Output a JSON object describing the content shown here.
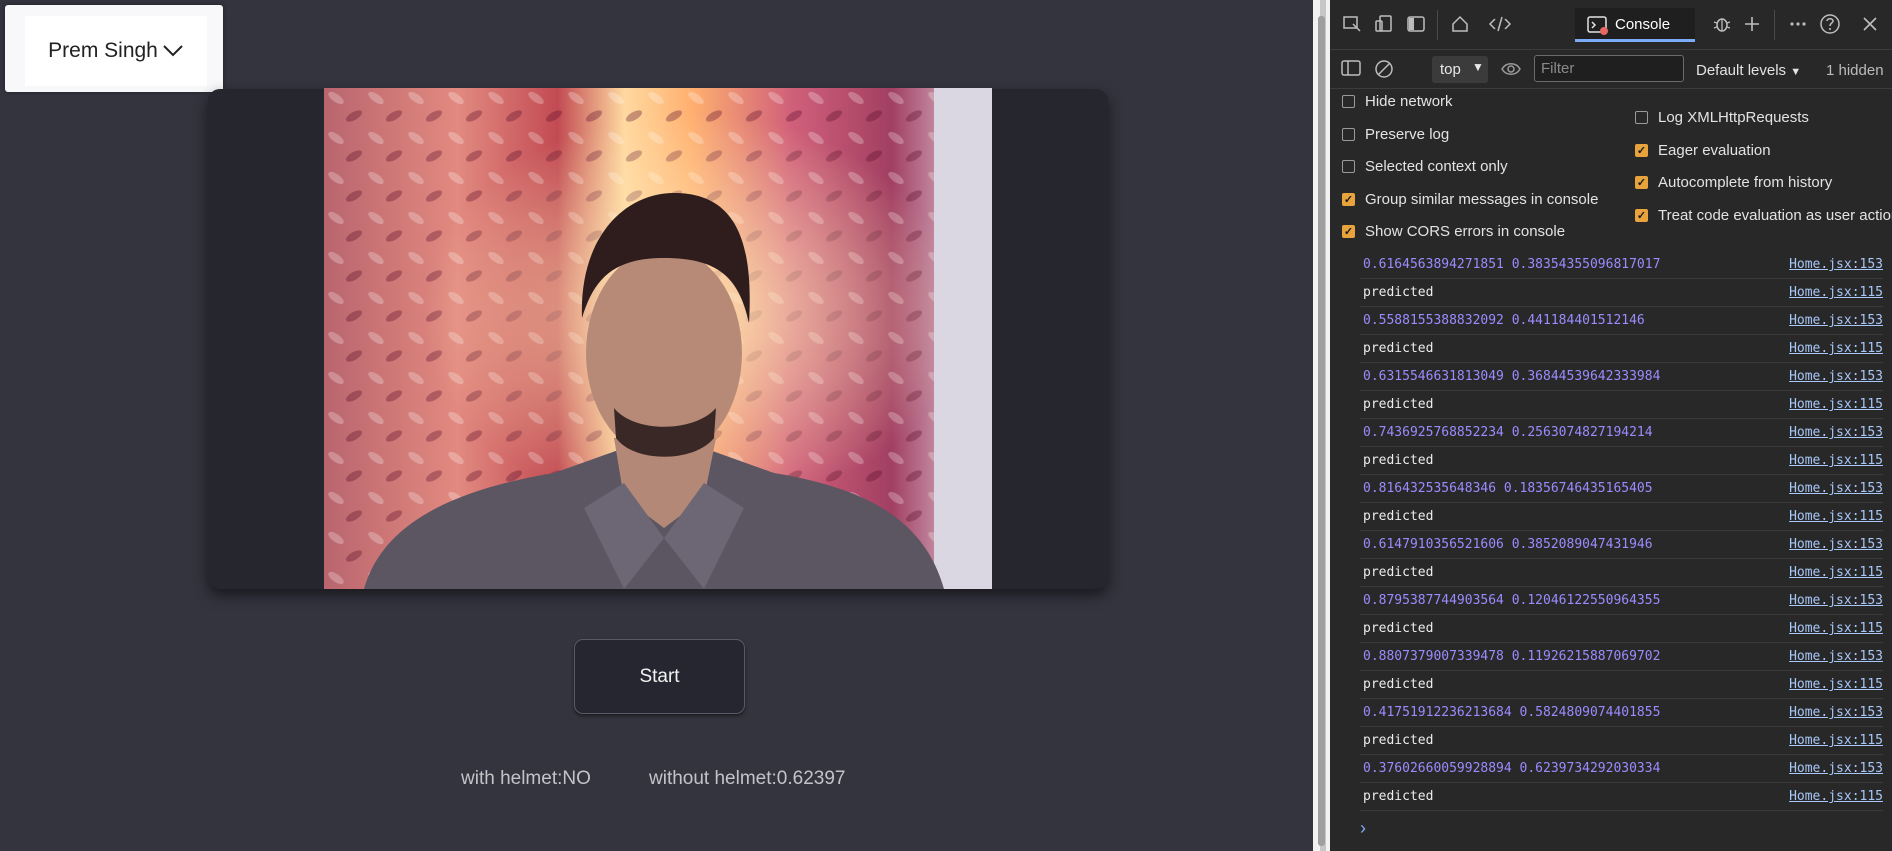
{
  "app": {
    "user_name": "Prem Singh",
    "start_label": "Start",
    "with_helmet": "with helmet:NO",
    "without_helmet": "without helmet:0.62397"
  },
  "devtools": {
    "tab_console": "Console",
    "context": "top",
    "filter_placeholder": "Filter",
    "levels": "Default levels",
    "hidden": "1 hidden",
    "settings_left": [
      {
        "label": "Hide network",
        "checked": false
      },
      {
        "label": "Preserve log",
        "checked": false
      },
      {
        "label": "Selected context only",
        "checked": false
      },
      {
        "label": "Group similar messages in console",
        "checked": true
      },
      {
        "label": "Show CORS errors in console",
        "checked": true
      }
    ],
    "settings_right": [
      {
        "label": "Log XMLHttpRequests",
        "checked": false
      },
      {
        "label": "Eager evaluation",
        "checked": true
      },
      {
        "label": "Autocomplete from history",
        "checked": true
      },
      {
        "label": "Treat code evaluation as user action",
        "checked": true
      }
    ],
    "log": [
      {
        "msg": "0.6164563894271851 0.38354355096817017",
        "src": "Home.jsx:153",
        "kind": "num"
      },
      {
        "msg": "predicted",
        "src": "Home.jsx:115",
        "kind": "txt"
      },
      {
        "msg": "0.5588155388832092 0.441184401512146",
        "src": "Home.jsx:153",
        "kind": "num"
      },
      {
        "msg": "predicted",
        "src": "Home.jsx:115",
        "kind": "txt"
      },
      {
        "msg": "0.6315546631813049 0.36844539642333984",
        "src": "Home.jsx:153",
        "kind": "num"
      },
      {
        "msg": "predicted",
        "src": "Home.jsx:115",
        "kind": "txt"
      },
      {
        "msg": "0.7436925768852234 0.2563074827194214",
        "src": "Home.jsx:153",
        "kind": "num"
      },
      {
        "msg": "predicted",
        "src": "Home.jsx:115",
        "kind": "txt"
      },
      {
        "msg": "0.816432535648346 0.18356746435165405",
        "src": "Home.jsx:153",
        "kind": "num"
      },
      {
        "msg": "predicted",
        "src": "Home.jsx:115",
        "kind": "txt"
      },
      {
        "msg": "0.6147910356521606 0.3852089047431946",
        "src": "Home.jsx:153",
        "kind": "num"
      },
      {
        "msg": "predicted",
        "src": "Home.jsx:115",
        "kind": "txt"
      },
      {
        "msg": "0.8795387744903564 0.12046122550964355",
        "src": "Home.jsx:153",
        "kind": "num"
      },
      {
        "msg": "predicted",
        "src": "Home.jsx:115",
        "kind": "txt"
      },
      {
        "msg": "0.8807379007339478 0.11926215887069702",
        "src": "Home.jsx:153",
        "kind": "num"
      },
      {
        "msg": "predicted",
        "src": "Home.jsx:115",
        "kind": "txt"
      },
      {
        "msg": "0.41751912236213684 0.5824809074401855",
        "src": "Home.jsx:153",
        "kind": "num"
      },
      {
        "msg": "predicted",
        "src": "Home.jsx:115",
        "kind": "txt"
      },
      {
        "msg": "0.37602660059928894 0.6239734292030334",
        "src": "Home.jsx:153",
        "kind": "num"
      },
      {
        "msg": "predicted",
        "src": "Home.jsx:115",
        "kind": "txt"
      }
    ]
  },
  "colors": {
    "page_bg": "#34343f",
    "card_bg": "#26262f",
    "devtools_bg": "#282828",
    "log_number": "#9a8cff",
    "link": "#a8c7fa",
    "checkbox_on": "#e8a33c"
  }
}
